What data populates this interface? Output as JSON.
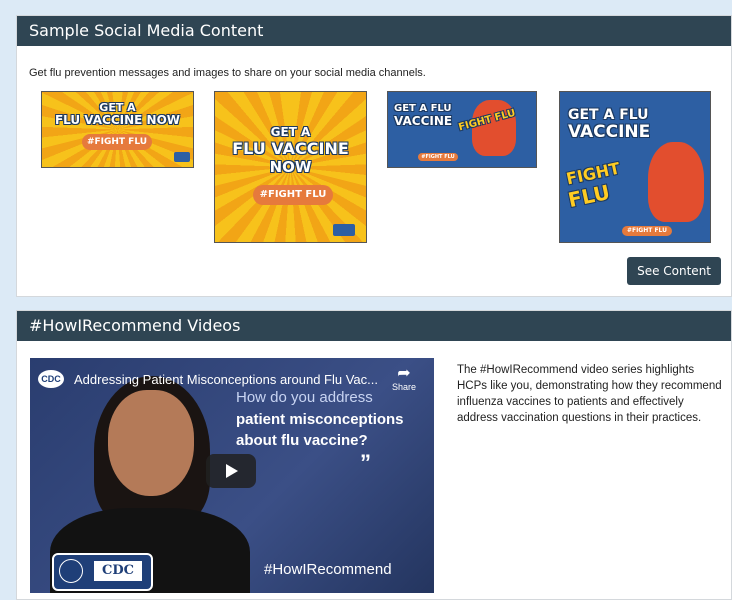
{
  "section1": {
    "title": "Sample Social Media Content",
    "intro": "Get flu prevention messages and images to share on your social media channels.",
    "button_label": "See Content",
    "thumbs": [
      {
        "line1": "GET A",
        "line2": "FLU VACCINE NOW",
        "pill": "#FIGHT FLU"
      },
      {
        "line1": "GET A",
        "line2": "FLU VACCINE",
        "line3": "NOW",
        "pill": "#FIGHT FLU"
      },
      {
        "line1": "GET A FLU",
        "line2": "VACCINE",
        "stamp": "FIGHT FLU",
        "pill": "#FIGHT FLU"
      },
      {
        "line1": "GET A FLU",
        "line2": "VACCINE",
        "stamp1": "FIGHT",
        "stamp2": "FLU",
        "pill": "#FIGHT FLU"
      }
    ]
  },
  "section2": {
    "title": "#HowIRecommend Videos",
    "video_title": "Addressing Patient Misconceptions around Flu Vac...",
    "share_label": "Share",
    "cdc_badge": "CDC",
    "quote_line1": "How do you address",
    "quote_line2": "patient misconceptions",
    "quote_line3": "about flu vaccine?",
    "hashtag": "#HowIRecommend",
    "logo_text": "CDC",
    "description": "The #HowIRecommend video series highlights HCPs like you, demonstrating how they recommend influenza vaccines to patients and effectively address vaccination questions in their practices."
  },
  "colors": {
    "header_bg": "#2f4553",
    "page_bg": "#dceaf6",
    "play_red": "#ff0000",
    "pill_orange": "#e67a3c"
  },
  "icons": [
    "share-icon",
    "play-icon",
    "cdc-logo-icon"
  ]
}
